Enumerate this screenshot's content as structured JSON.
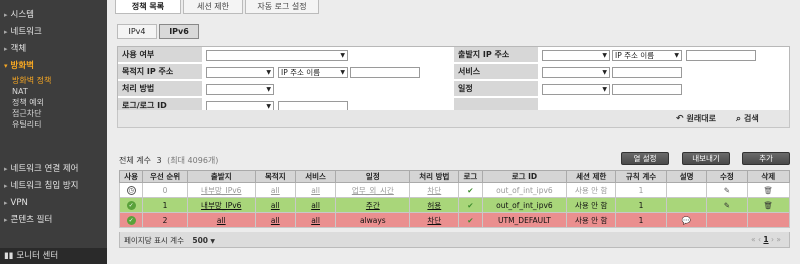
{
  "sidebar": {
    "items": [
      {
        "label": "시스템"
      },
      {
        "label": "네트워크"
      },
      {
        "label": "객체"
      },
      {
        "label": "방화벽",
        "active": true
      }
    ],
    "sub_items": [
      {
        "label": "방화벽 정책",
        "active": true
      },
      {
        "label": "NAT"
      },
      {
        "label": "정책 예외"
      },
      {
        "label": "접근차단"
      },
      {
        "label": "유틸리티"
      }
    ],
    "lower_items": [
      {
        "label": "네트워크 연결 제어"
      },
      {
        "label": "네트워크 침입 방지"
      },
      {
        "label": "VPN"
      },
      {
        "label": "콘텐츠 필터"
      }
    ],
    "bottom": "모니터 센터"
  },
  "top_tabs": [
    "정책 목록",
    "세션 제한",
    "자동 로그 설정"
  ],
  "ip_tabs": [
    "IPv4",
    "IPv6"
  ],
  "filter": {
    "labels": {
      "use": "사용 여부",
      "dest_ip": "목적지 IP 주소",
      "action": "처리 방법",
      "log": "로그/로그 ID",
      "src_ip": "출발지 IP 주소",
      "service": "서비스",
      "schedule": "일정"
    },
    "ip_name_option": "IP 주소 이름",
    "reset": "원래대로",
    "search": "검색"
  },
  "count": {
    "label": "전체 계수",
    "value": "3",
    "sub": "(최대 4096개)"
  },
  "buttons": {
    "col_settings": "열 설정",
    "export": "내보내기",
    "add": "추가"
  },
  "table": {
    "headers": [
      "사용",
      "우선 순위",
      "출발지",
      "목적지",
      "서비스",
      "일정",
      "처리 방법",
      "로그",
      "로그 ID",
      "세션 제한",
      "규칙 계수",
      "설명",
      "수정",
      "삭제"
    ],
    "rows": [
      {
        "priority": "0",
        "src": "내부망_IPv6",
        "dst": "all",
        "svc": "all",
        "sched": "업무_외_시간",
        "action": "차단",
        "log_id": "out_of_int_ipv6",
        "session": "사용 안 함",
        "count": "1"
      },
      {
        "priority": "1",
        "src": "내부망_IPv6",
        "dst": "all",
        "svc": "all",
        "sched": "주간",
        "action": "허용",
        "log_id": "out_of_int_ipv6",
        "session": "사용 안 함",
        "count": "1"
      },
      {
        "priority": "2",
        "src": "all",
        "dst": "all",
        "svc": "all",
        "sched": "always",
        "action": "차단",
        "log_id": "UTM_DEFAULT",
        "session": "사용 안 함",
        "count": "1"
      }
    ]
  },
  "footer": {
    "per_page_label": "페이지당 표시 계수",
    "per_page_value": "500",
    "page": "1"
  },
  "colors": {
    "sidebar_bg": "#3d3d3d",
    "active_orange": "#f5a623",
    "row_allow": "#a9d67a",
    "row_block": "#ea8f8f"
  }
}
